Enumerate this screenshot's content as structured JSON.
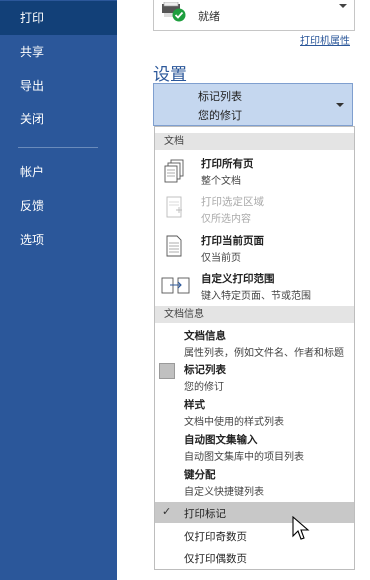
{
  "colors": {
    "sidebar": "#2b579a",
    "sidebar_active": "#124078",
    "accent": "#2b579a",
    "selector_bg": "#c5d7ef",
    "section_bg": "#e4e4e4",
    "selected_bg": "#c8c8c8"
  },
  "sidebar": {
    "items": [
      {
        "label": "打印",
        "active": true
      },
      {
        "label": "共享"
      },
      {
        "label": "导出"
      },
      {
        "label": "关闭"
      },
      {
        "label": "帐户"
      },
      {
        "label": "反馈"
      },
      {
        "label": "选项"
      }
    ]
  },
  "printer": {
    "status": "就绪",
    "properties_link": "打印机属性",
    "icon": "printer-ready-icon"
  },
  "settings": {
    "title": "设置",
    "selector": {
      "title": "标记列表",
      "subtitle": "您的修订"
    }
  },
  "menu": {
    "sections": [
      {
        "label": "文档"
      },
      {
        "label": "文档信息"
      }
    ],
    "document_items": [
      {
        "title": "打印所有页",
        "desc": "整个文档",
        "icon": "all-pages-icon"
      },
      {
        "title": "打印选定区域",
        "desc": "仅所选内容",
        "icon": "selection-icon",
        "disabled": true
      },
      {
        "title": "打印当前页面",
        "desc": "仅当前页",
        "icon": "current-page-icon"
      },
      {
        "title": "自定义打印范围",
        "desc": "键入特定页面、节或范围",
        "icon": "custom-range-icon"
      }
    ],
    "info_items": [
      {
        "title": "文档信息",
        "desc": "属性列表，例如文件名、作者和标题"
      },
      {
        "title": "标记列表",
        "desc": "您的修订"
      },
      {
        "title": "样式",
        "desc": "文档中使用的样式列表"
      },
      {
        "title": "自动图文集输入",
        "desc": "自动图文集库中的项目列表"
      },
      {
        "title": "键分配",
        "desc": "自定义快捷键列表"
      }
    ],
    "bottom_items": [
      {
        "label": "打印标记",
        "checked": true
      },
      {
        "label": "仅打印奇数页"
      },
      {
        "label": "仅打印偶数页"
      }
    ]
  }
}
